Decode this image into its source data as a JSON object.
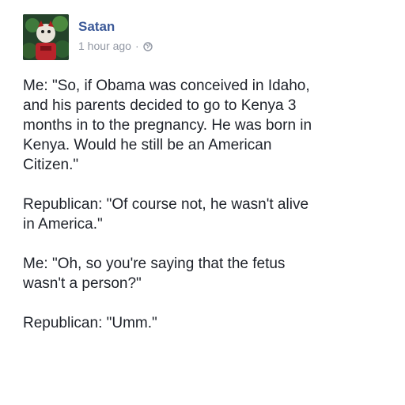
{
  "post": {
    "author": "Satan",
    "timestamp": "1 hour ago",
    "separator": "·",
    "privacy_icon": "globe-icon",
    "paragraphs": [
      "Me: \"So, if Obama was conceived in Idaho,\nand his parents decided to go to Kenya 3\nmonths in to the pregnancy. He was born in\nKenya. Would he still be an American\nCitizen.\"",
      "Republican: \"Of course not, he wasn't alive\nin America.\"",
      "Me: \"Oh, so you're saying that the fetus\nwasn't a person?\"",
      "Republican: \"Umm.\""
    ]
  },
  "colors": {
    "author_name": "#3b5998",
    "meta_text": "#9197a3",
    "body_text": "#1d2129",
    "background": "#ffffff"
  }
}
